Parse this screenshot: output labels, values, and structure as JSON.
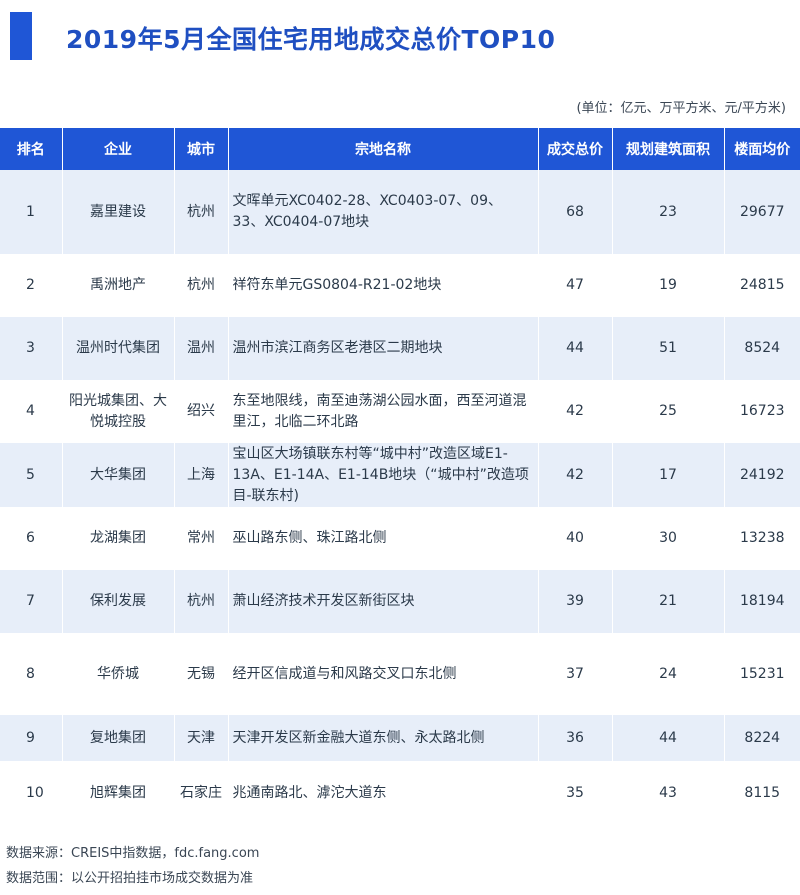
{
  "title": "2019年5月全国住宅用地成交总价TOP10",
  "unit_note": "(单位：亿元、万平方米、元/平方米)",
  "columns": [
    "排名",
    "企业",
    "城市",
    "宗地名称",
    "成交总价",
    "规划建筑面积",
    "楼面均价"
  ],
  "rows": [
    {
      "rank": "1",
      "company": "嘉里建设",
      "city": "杭州",
      "plot": "文晖单元XC0402-28、XC0403-07、09、33、XC0404-07地块",
      "price": "68",
      "area": "23",
      "avg": "29677"
    },
    {
      "rank": "2",
      "company": "禹洲地产",
      "city": "杭州",
      "plot": "祥符东单元GS0804-R21-02地块",
      "price": "47",
      "area": "19",
      "avg": "24815"
    },
    {
      "rank": "3",
      "company": "温州时代集团",
      "city": "温州",
      "plot": "温州市滨江商务区老港区二期地块",
      "price": "44",
      "area": "51",
      "avg": "8524"
    },
    {
      "rank": "4",
      "company": "阳光城集团、大悦城控股",
      "city": "绍兴",
      "plot": "东至地限线，南至迪荡湖公园水面，西至河道混里江，北临二环北路",
      "price": "42",
      "area": "25",
      "avg": "16723"
    },
    {
      "rank": "5",
      "company": "大华集团",
      "city": "上海",
      "plot": "宝山区大场镇联东村等“城中村”改造区域E1-13A、E1-14A、E1-14B地块（“城中村”改造项目-联东村)",
      "price": "42",
      "area": "17",
      "avg": "24192"
    },
    {
      "rank": "6",
      "company": "龙湖集团",
      "city": "常州",
      "plot": "巫山路东侧、珠江路北侧",
      "price": "40",
      "area": "30",
      "avg": "13238"
    },
    {
      "rank": "7",
      "company": "保利发展",
      "city": "杭州",
      "plot": "萧山经济技术开发区新街区块",
      "price": "39",
      "area": "21",
      "avg": "18194"
    },
    {
      "rank": "8",
      "company": "华侨城",
      "city": "无锡",
      "plot": "经开区信成道与和风路交叉口东北侧",
      "price": "37",
      "area": "24",
      "avg": "15231"
    },
    {
      "rank": "9",
      "company": "复地集团",
      "city": "天津",
      "plot": "天津开发区新金融大道东侧、永太路北侧",
      "price": "36",
      "area": "44",
      "avg": "8224"
    },
    {
      "rank": "10",
      "company": "旭辉集团",
      "city": "石家庄",
      "plot": "兆通南路北、滹沱大道东",
      "price": "35",
      "area": "43",
      "avg": "8115"
    }
  ],
  "source": "数据来源：CREIS中指数据，fdc.fang.com",
  "scope": "数据范围：以公开招拍挂市场成交数据为准",
  "colors": {
    "accent": "#1f56d6",
    "row_alt": "#e7eef9"
  }
}
